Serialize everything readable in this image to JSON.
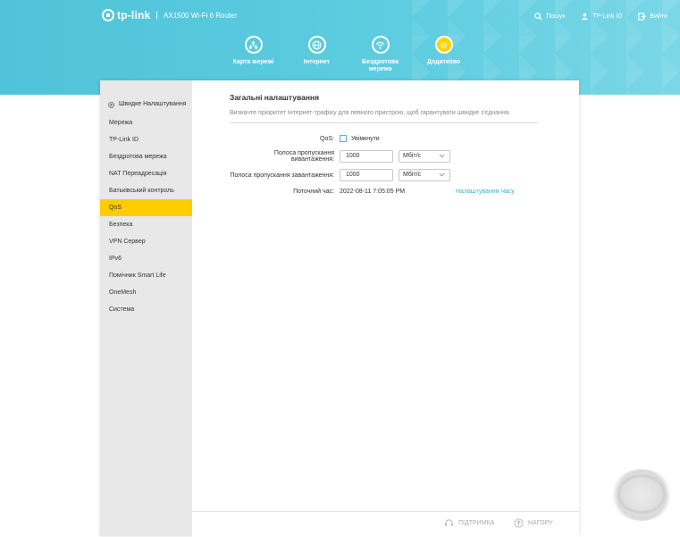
{
  "header": {
    "brand": "tp-link",
    "separator": "|",
    "model": "AX1500 Wi-Fi 6 Router",
    "links": [
      {
        "label": "Пошук",
        "icon": "search-icon"
      },
      {
        "label": "TP-Link ID",
        "icon": "cloud-user-icon"
      },
      {
        "label": "Вийти",
        "icon": "logout-icon"
      }
    ],
    "nav": [
      {
        "label": "Карта мережі",
        "icon": "network-map-icon",
        "active": false
      },
      {
        "label": "Інтернет",
        "icon": "globe-icon",
        "active": false
      },
      {
        "label": "Бездротова мережа",
        "icon": "wifi-icon",
        "active": false
      },
      {
        "label": "Додатково",
        "icon": "gear-icon",
        "active": true
      }
    ]
  },
  "sidebar": {
    "quick_setup": "Швидке Налаштування",
    "items": [
      {
        "label": "Мережа",
        "active": false
      },
      {
        "label": "TP-Link ID",
        "active": false
      },
      {
        "label": "Бездротова мережа",
        "active": false
      },
      {
        "label": "NAT Переадресація",
        "active": false
      },
      {
        "label": "Батьківський контроль",
        "active": false
      },
      {
        "label": "QoS",
        "active": true
      },
      {
        "label": "Безпека",
        "active": false
      },
      {
        "label": "VPN Сервер",
        "active": false
      },
      {
        "label": "IPv6",
        "active": false
      },
      {
        "label": "Помічник Smart Life",
        "active": false
      },
      {
        "label": "OneMesh",
        "active": false
      },
      {
        "label": "Система",
        "active": false
      }
    ]
  },
  "main": {
    "title": "Загальні налаштування",
    "description": "Визначте пріоритет Інтернет-трафіку для певного пристрою, щоб гарантувати швидке з'єднання.",
    "qos_label": "QoS:",
    "qos_checkbox_label": "Увімкнути",
    "qos_enabled": false,
    "upload_label": "Полоса пропускання вивантаження:",
    "upload_value": "1000",
    "upload_unit": "Мбіт/с",
    "download_label": "Полоса пропускання завантаження:",
    "download_value": "1000",
    "download_unit": "Мбіт/с",
    "time_label": "Поточний час:",
    "time_value": "2022-08-11 7:05:05 PM",
    "time_link": "Налаштування Часу"
  },
  "footer": {
    "support": "ПІДТРИМКА",
    "top": "НАГОРУ"
  },
  "colors": {
    "header": "#5ecde0",
    "accent_yellow": "#ffcc00",
    "link": "#3ab0c8"
  }
}
